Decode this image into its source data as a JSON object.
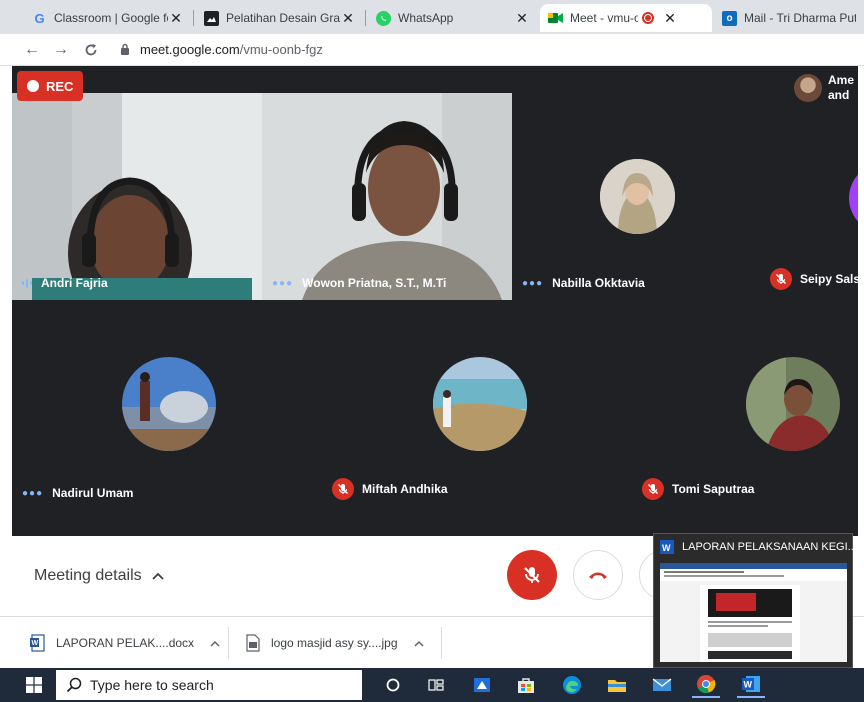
{
  "browser": {
    "tabs": [
      {
        "title": "Classroom | Google for Education",
        "icon": "google-icon"
      },
      {
        "title": "Pelatihan Desain Grafis",
        "icon": "image-icon"
      },
      {
        "title": "WhatsApp",
        "icon": "whatsapp-icon"
      },
      {
        "title": "Meet - vmu-oonb-fgz",
        "icon": "meet-icon",
        "recording": true
      },
      {
        "title": "Mail - Tri Dharma Putra",
        "icon": "outlook-icon"
      }
    ],
    "url_host": "meet.google.com",
    "url_path": "/vmu-oonb-fgz"
  },
  "meet": {
    "rec_label": "REC",
    "notice_text": "Ame and",
    "notice_line1": "Ame",
    "notice_line2": "and",
    "participants": [
      {
        "name": "Andri Fajria",
        "status": "speaking"
      },
      {
        "name": "Wowon Priatna, S.T., M.Ti",
        "status": "more"
      },
      {
        "name": "Nabilla Okktavia",
        "status": "more"
      },
      {
        "name": "Seipy Sals",
        "status": "muted"
      },
      {
        "name": "Nadirul Umam",
        "status": "more"
      },
      {
        "name": "Miftah Andhika",
        "status": "muted"
      },
      {
        "name": "Tomi Saputraa",
        "status": "muted"
      }
    ],
    "meeting_details_label": "Meeting details"
  },
  "downloads": [
    {
      "name": "LAPORAN PELAK....docx",
      "icon": "word-doc-icon"
    },
    {
      "name": "logo masjid asy sy....jpg",
      "icon": "image-file-icon"
    }
  ],
  "taskbar": {
    "search_placeholder": "Type here to search",
    "preview_title": "LAPORAN PELAKSANAAN KEGI..."
  },
  "colors": {
    "meet_bg": "#202124",
    "red": "#d93025",
    "taskbar": "#1f2a3a"
  }
}
